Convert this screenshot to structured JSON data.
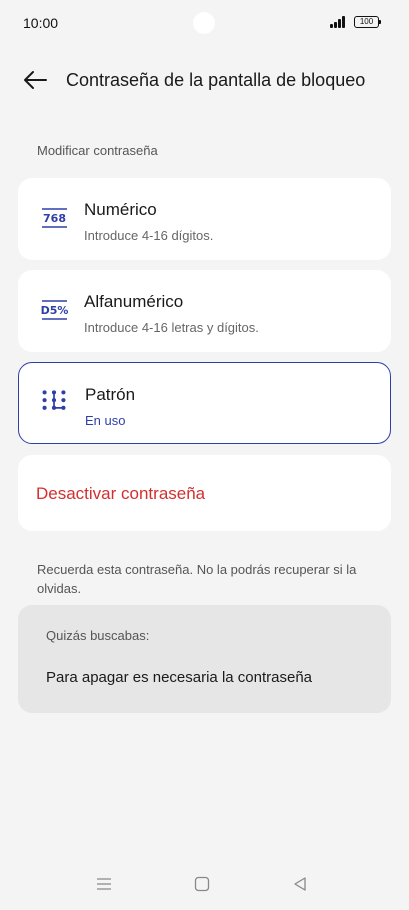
{
  "status": {
    "time": "10:00",
    "battery": "100"
  },
  "header": {
    "title": "Contraseña de la pantalla de bloqueo",
    "back_icon": "arrow-left-icon"
  },
  "section_label": "Modificar contraseña",
  "options": [
    {
      "icon": "numeric-icon",
      "icon_text": "768",
      "title": "Numérico",
      "subtitle": "Introduce 4-16 dígitos.",
      "selected": false
    },
    {
      "icon": "alphanumeric-icon",
      "icon_text": "D5%",
      "title": "Alfanumérico",
      "subtitle": "Introduce 4-16 letras y dígitos.",
      "selected": false
    },
    {
      "icon": "pattern-icon",
      "title": "Patrón",
      "subtitle": "En uso",
      "selected": true
    }
  ],
  "deactivate_label": "Desactivar contraseña",
  "note": "Recuerda esta contraseña. No la podrás recuperar si la olvidas.",
  "suggestions": {
    "label": "Quizás buscabas:",
    "items": [
      "Para apagar es necesaria la contraseña"
    ]
  },
  "colors": {
    "accent": "#2e3fa8",
    "danger": "#d32f2f",
    "background": "#f4f4f4",
    "card": "#ffffff"
  }
}
